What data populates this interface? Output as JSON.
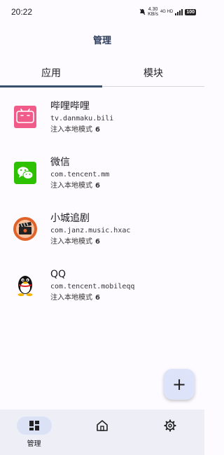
{
  "status_bar": {
    "time": "20:22",
    "network_speed": "4.30",
    "network_unit": "KB/s",
    "signal_label": "4G HD",
    "battery": "100"
  },
  "app_bar": {
    "title": "管理"
  },
  "tabs": [
    {
      "label": "应用",
      "active": true
    },
    {
      "label": "模块",
      "active": false
    }
  ],
  "apps": [
    {
      "name": "哔哩哔哩",
      "package": "tv.danmaku.bili",
      "mode_label": "注入本地模式",
      "mode_value": "6",
      "icon": "bilibili-icon",
      "icon_color": "#f15b8a"
    },
    {
      "name": "微信",
      "package": "com.tencent.mm",
      "mode_label": "注入本地模式",
      "mode_value": "6",
      "icon": "wechat-icon",
      "icon_color": "#2dc100"
    },
    {
      "name": "小城追剧",
      "package": "com.janz.music.hxac",
      "mode_label": "注入本地模式",
      "mode_value": "6",
      "icon": "clapperboard-icon",
      "icon_color": "#e0622a"
    },
    {
      "name": "QQ",
      "package": "com.tencent.mobileqq",
      "mode_label": "注入本地模式",
      "mode_value": "6",
      "icon": "qq-penguin-icon",
      "icon_color": "#111111"
    }
  ],
  "fab": {
    "label": "+"
  },
  "nav": [
    {
      "label": "管理",
      "icon": "dashboard-icon",
      "active": true
    },
    {
      "label": "",
      "icon": "home-icon",
      "active": false
    },
    {
      "label": "",
      "icon": "gear-icon",
      "active": false
    }
  ],
  "colors": {
    "accent": "#3a4f6e",
    "nav_background": "#eeeef6",
    "fab_background": "#dde3f8"
  }
}
